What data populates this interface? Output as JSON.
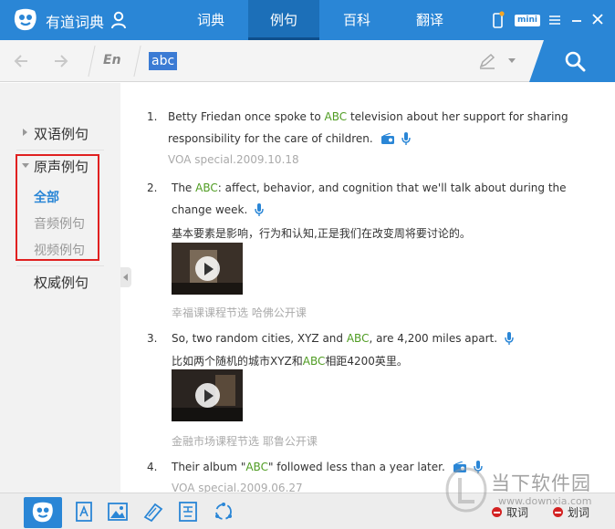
{
  "app": {
    "title": "有道词典",
    "nav_tabs": [
      {
        "label": "词典"
      },
      {
        "label": "例句"
      },
      {
        "label": "百科"
      },
      {
        "label": "翻译"
      }
    ],
    "mini_label": "mini"
  },
  "search": {
    "lang": "En",
    "query": "abc"
  },
  "sidebar": {
    "bilingual": "双语例句",
    "original": "原声例句",
    "sub_all": "全部",
    "sub_audio": "音频例句",
    "sub_video": "视频例句",
    "authority": "权威例句"
  },
  "examples": [
    {
      "num": "1.",
      "en_pre": "Betty Friedan once spoke to ",
      "en_hl": "ABC",
      "en_post": " television about her support for sharing responsibility for the care of children.",
      "cn": "",
      "source": "VOA special.2009.10.18"
    },
    {
      "num": "2.",
      "en_pre": "The ",
      "en_hl": "ABC",
      "en_post": ": affect, behavior, and cognition that we'll talk about during the change week.",
      "cn": "基本要素是影响，行为和认知,正是我们在改变周将要讨论的。",
      "source": "幸福课课程节选 哈佛公开课"
    },
    {
      "num": "3.",
      "en_pre": "So, two random cities, XYZ and ",
      "en_hl": "ABC",
      "en_post": ", are 4,200 miles apart.",
      "cn_pre": "比如两个随机的城市XYZ和",
      "cn_hl": "ABC",
      "cn_post": "相距4200英里。",
      "source": "金融市场课程节选 耶鲁公开课"
    },
    {
      "num": "4.",
      "en_pre": "Their album \"",
      "en_hl": "ABC",
      "en_post": "\" followed less than a year later.",
      "source": "VOA special.2009.06.27"
    }
  ],
  "bottom": {
    "cancel": "取词",
    "wordlist": "划词"
  },
  "watermark": {
    "text": "当下软件园",
    "url": "www.downxia.com"
  },
  "colors": {
    "brand_blue": "#2a86d6",
    "highlight_green": "#4f9c22",
    "annotation_red": "#e02020"
  }
}
